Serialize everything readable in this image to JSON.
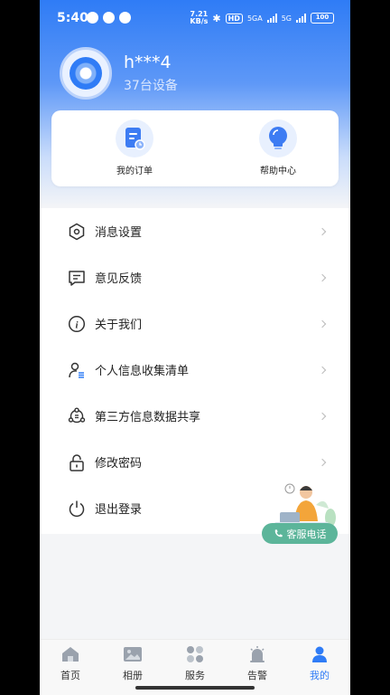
{
  "status_bar": {
    "time": "5:40",
    "speed_value": "7.21",
    "speed_unit": "KB/s",
    "hd": "HD",
    "net1": "5GA",
    "net2": "5G",
    "battery": "100"
  },
  "profile": {
    "username": "h***4",
    "device_count": "37台设备"
  },
  "quick_actions": [
    {
      "label": "我的订单",
      "icon": "order-icon"
    },
    {
      "label": "帮助中心",
      "icon": "lightbulb-icon"
    }
  ],
  "menu": [
    {
      "label": "消息设置",
      "icon": "hexagon-settings-icon"
    },
    {
      "label": "意见反馈",
      "icon": "feedback-icon"
    },
    {
      "label": "关于我们",
      "icon": "info-icon"
    },
    {
      "label": "个人信息收集清单",
      "icon": "person-list-icon"
    },
    {
      "label": "第三方信息数据共享",
      "icon": "share-icon"
    },
    {
      "label": "修改密码",
      "icon": "lock-icon"
    },
    {
      "label": "退出登录",
      "icon": "power-icon"
    }
  ],
  "customer_service": {
    "label": "客服电话",
    "icon": "phone-icon"
  },
  "tabs": [
    {
      "label": "首页",
      "icon": "home-icon",
      "active": false
    },
    {
      "label": "相册",
      "icon": "album-icon",
      "active": false
    },
    {
      "label": "服务",
      "icon": "services-icon",
      "active": false
    },
    {
      "label": "告警",
      "icon": "alarm-icon",
      "active": false
    },
    {
      "label": "我的",
      "icon": "profile-icon",
      "active": true
    }
  ],
  "colors": {
    "accent": "#2f7cf6",
    "service_button": "#5cb59a",
    "background": "#f4f5f7"
  }
}
